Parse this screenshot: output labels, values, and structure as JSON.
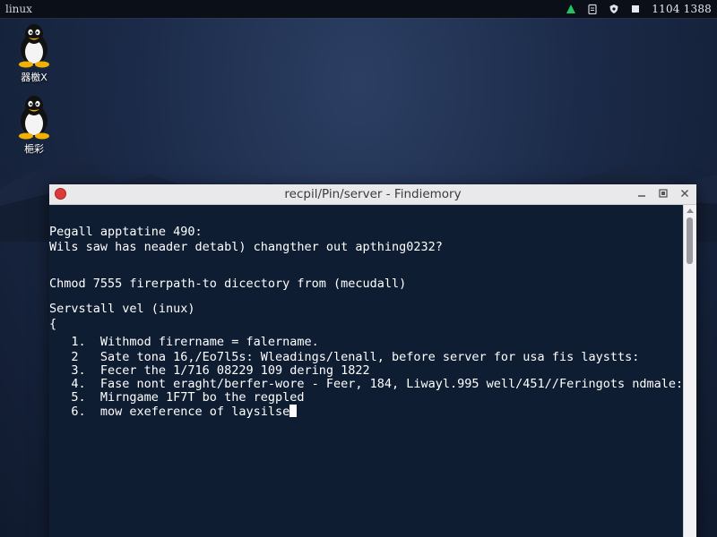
{
  "topbar": {
    "app_label": "linux",
    "clock": "1104 1388",
    "tray_icons": [
      "network-up-icon",
      "clipboard-icon",
      "shield-icon",
      "square-icon"
    ]
  },
  "desktop": {
    "icons": [
      {
        "label": "器檄X",
        "icon": "tux-icon"
      },
      {
        "label": "梔彩",
        "icon": "tux-icon"
      }
    ]
  },
  "window": {
    "title": "recpil/Pin/server - Findiemory",
    "controls": [
      "minimize-icon",
      "maximize-icon",
      "close-icon"
    ]
  },
  "terminal": {
    "lines": [
      "Pegall apptatine 490:",
      "Wils saw has neader detabl) changther out apthing0232?",
      "Chmod 7555 firerpath-to dicectory from (mecudall)",
      "Servstall vel (inux)",
      "{",
      "   1.  Withmod firername = falername.",
      "   2   Sate tona 16,/Eo7l5s: Wleadings/lenall, before server for usa fis laystts:",
      "   3.  Fecer the 1/716 08229 109 dering 1822",
      "   4.  Fase nont eraght/berfer-wore - Feer, 184, Liwayl.995 well/451//Feringots ndmale:",
      "   5.  Mirngame 1F7T bo the regpled",
      "   6.  mow exeference of laysilse"
    ]
  },
  "colors": {
    "terminal_bg": "#0f1d33",
    "close_button": "#dd3b3b",
    "tray_green": "#22c55e"
  }
}
